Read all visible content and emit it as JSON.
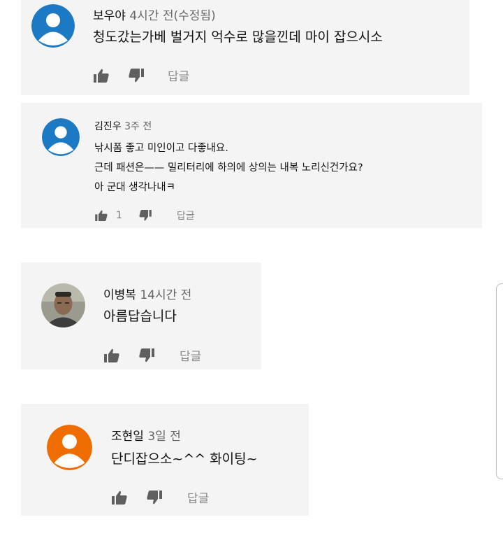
{
  "comments": [
    {
      "author": "보우야",
      "time": "4시간 전(수정됨)",
      "lines": [
        "청도갔는가베 벌거지 억수로 많을낀데 마이 잡으시소"
      ],
      "likes": "",
      "reply": "답글",
      "avatar": "default-blue"
    },
    {
      "author": "김진우",
      "time": "3주 전",
      "lines": [
        "낚시폼 좋고 미인이고 다좋내요.",
        "근데 패션은—— 밀리터리에 하의에 상의는  내복 노리신건가요?",
        "아 군대 생각나내ㅋ"
      ],
      "likes": "1",
      "reply": "답글",
      "avatar": "default-blue"
    },
    {
      "author": "이병복",
      "time": "14시간 전",
      "lines": [
        "아름답습니다"
      ],
      "likes": "",
      "reply": "답글",
      "avatar": "photo"
    },
    {
      "author": "조현일",
      "time": "3일 전",
      "lines": [
        "단디잡으소~^^ 화이팅~"
      ],
      "likes": "",
      "reply": "답글",
      "avatar": "default-orange"
    }
  ],
  "colors": {
    "card_bg": "#f4f4f4",
    "avatar_blue": "#1c79c4",
    "avatar_orange": "#ef6c00",
    "icon_gray": "#5f5f5f"
  }
}
